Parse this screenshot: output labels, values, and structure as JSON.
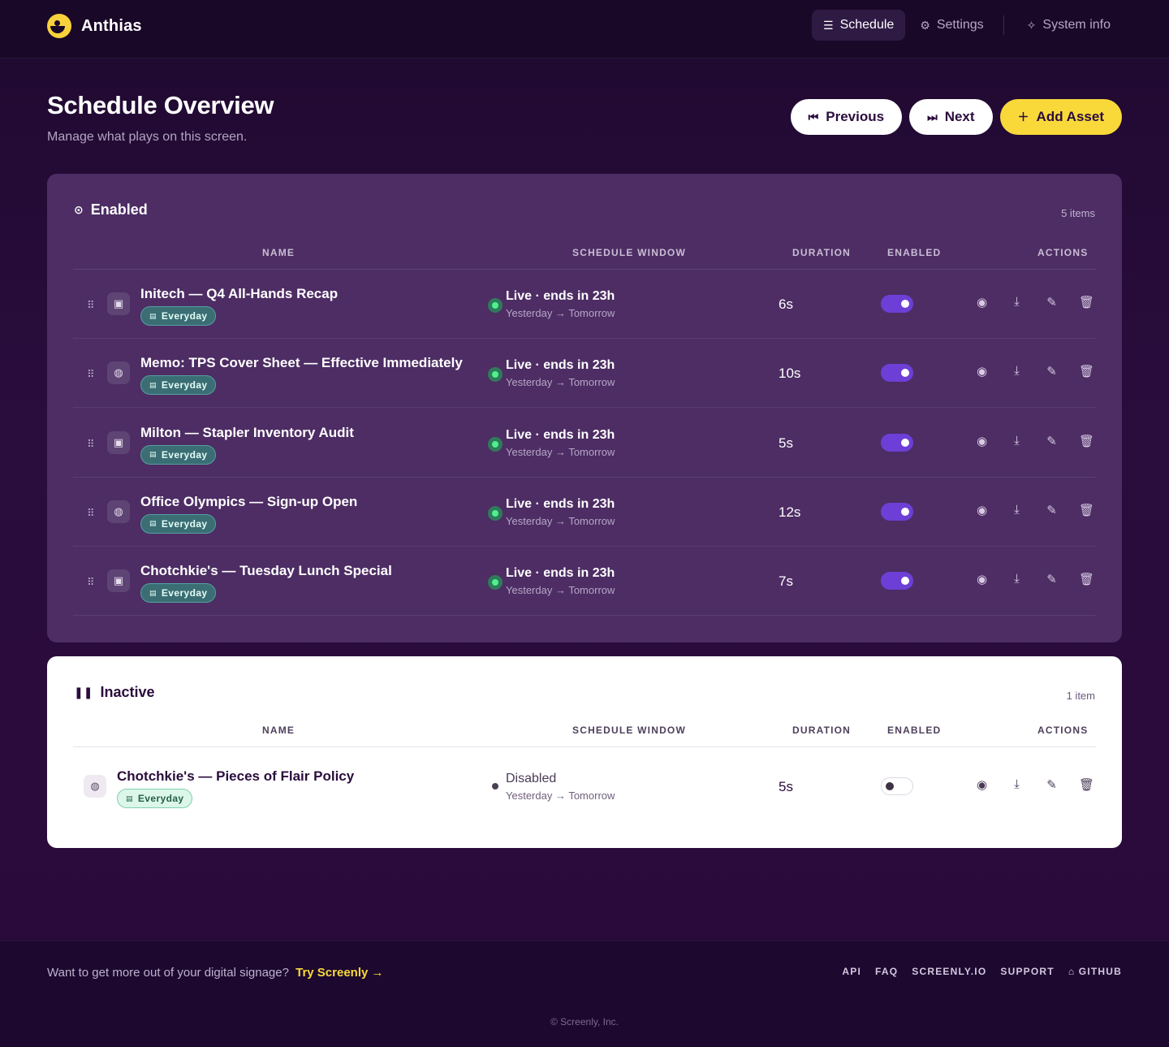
{
  "app": {
    "name": "Anthias"
  },
  "nav": [
    {
      "icon": "schedule-icon",
      "glyph": "☰",
      "label": "Schedule",
      "active": true
    },
    {
      "icon": "gear-icon",
      "glyph": "⚙",
      "label": "Settings",
      "active": false
    },
    {
      "icon": "pulse-icon",
      "glyph": "✧",
      "label": "System info",
      "active": false
    }
  ],
  "page": {
    "title": "Schedule Overview",
    "subtitle": "Manage what plays on this screen."
  },
  "buttons": {
    "previous": "Previous",
    "next": "Next",
    "add": "Add Asset"
  },
  "columns": {
    "name": "NAME",
    "window": "SCHEDULE WINDOW",
    "duration": "DURATION",
    "enabled": "ENABLED",
    "actions": "ACTIONS"
  },
  "enabled_section": {
    "title": "Enabled",
    "count": "5 items",
    "rows": [
      {
        "name": "Initech — Q4 All-Hands Recap",
        "type_icon": "image-icon",
        "tag": "Everyday",
        "status": "Live · ends in 23h",
        "window": "Yesterday → Tomorrow",
        "duration": "6s",
        "enabled": true
      },
      {
        "name": "Memo: TPS Cover Sheet — Effective Immediately",
        "type_icon": "globe-icon",
        "tag": "Everyday",
        "status": "Live · ends in 23h",
        "window": "Yesterday → Tomorrow",
        "duration": "10s",
        "enabled": true
      },
      {
        "name": "Milton — Stapler Inventory Audit",
        "type_icon": "image-icon",
        "tag": "Everyday",
        "status": "Live · ends in 23h",
        "window": "Yesterday → Tomorrow",
        "duration": "5s",
        "enabled": true
      },
      {
        "name": "Office Olympics — Sign-up Open",
        "type_icon": "globe-icon",
        "tag": "Everyday",
        "status": "Live · ends in 23h",
        "window": "Yesterday → Tomorrow",
        "duration": "12s",
        "enabled": true
      },
      {
        "name": "Chotchkie's — Tuesday Lunch Special",
        "type_icon": "image-icon",
        "tag": "Everyday",
        "status": "Live · ends in 23h",
        "window": "Yesterday → Tomorrow",
        "duration": "7s",
        "enabled": true
      }
    ]
  },
  "inactive_section": {
    "title": "Inactive",
    "count": "1 item",
    "rows": [
      {
        "name": "Chotchkie's — Pieces of Flair Policy",
        "type_icon": "globe-icon",
        "tag": "Everyday",
        "status": "Disabled",
        "window": "Yesterday → Tomorrow",
        "duration": "5s",
        "enabled": false
      }
    ]
  },
  "footer": {
    "promo": "Want to get more out of your digital signage?",
    "promo_link": "Try Screenly →",
    "links": [
      "API",
      "FAQ",
      "SCREENLY.IO",
      "SUPPORT",
      "GITHUB"
    ],
    "copyright": "© Screenly, Inc."
  },
  "colors": {
    "accent": "#f9d93a",
    "toggle_on": "#6d3fd6",
    "live": "#4ff08f",
    "panel_enabled": "#4d2d64"
  }
}
